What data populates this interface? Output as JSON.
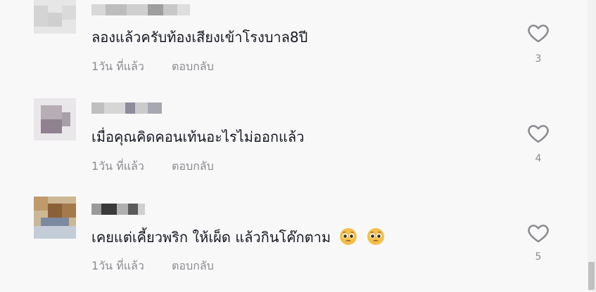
{
  "comments": [
    {
      "text": "ลองแล้วครับท้องเสียงเข้าโรงบาล8ปี",
      "time": "1วัน ที่แล้ว",
      "reply_label": "ตอบกลับ",
      "like_count": "3",
      "avatar_color": "#dcdcdc"
    },
    {
      "text": "เมื่อคุณคิดคอนเท้นอะไรไม่ออกแล้ว",
      "time": "1วัน ที่แล้ว",
      "reply_label": "ตอบกลับ",
      "like_count": "4",
      "avatar_color": "#9a8a95"
    },
    {
      "text": "เคยแต่เคี้ยวพริก ให้เผ็ด แล้วกินโค๊กตาม",
      "time": "1วัน ที่แล้ว",
      "reply_label": "ตอบกลับ",
      "like_count": "5",
      "avatar_color": "#b08a5c",
      "emojis": [
        "pleading-face-emoji",
        "pleading-face-emoji"
      ]
    }
  ],
  "colors": {
    "text": "#161823",
    "meta": "#8a8b91",
    "background": "#f8f8f8",
    "heart": "#8a8b91"
  }
}
